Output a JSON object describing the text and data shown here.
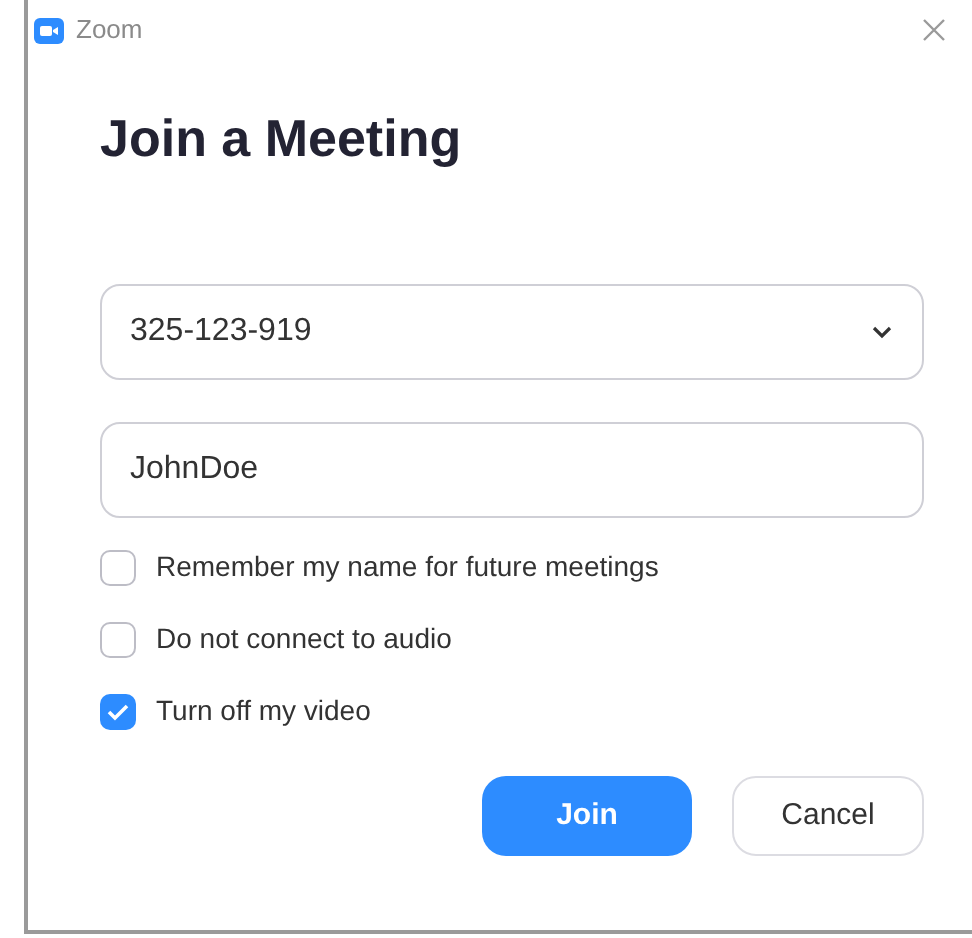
{
  "window": {
    "title": "Zoom"
  },
  "heading": "Join a Meeting",
  "meeting_id": {
    "value": "325-123-919"
  },
  "name_field": {
    "value": "JohnDoe"
  },
  "options": [
    {
      "label": "Remember my name for future meetings",
      "checked": false
    },
    {
      "label": "Do not connect to audio",
      "checked": false
    },
    {
      "label": "Turn off my video",
      "checked": true
    }
  ],
  "buttons": [
    {
      "label": "Join",
      "kind": "primary"
    },
    {
      "label": "Cancel",
      "kind": "secondary"
    }
  ]
}
